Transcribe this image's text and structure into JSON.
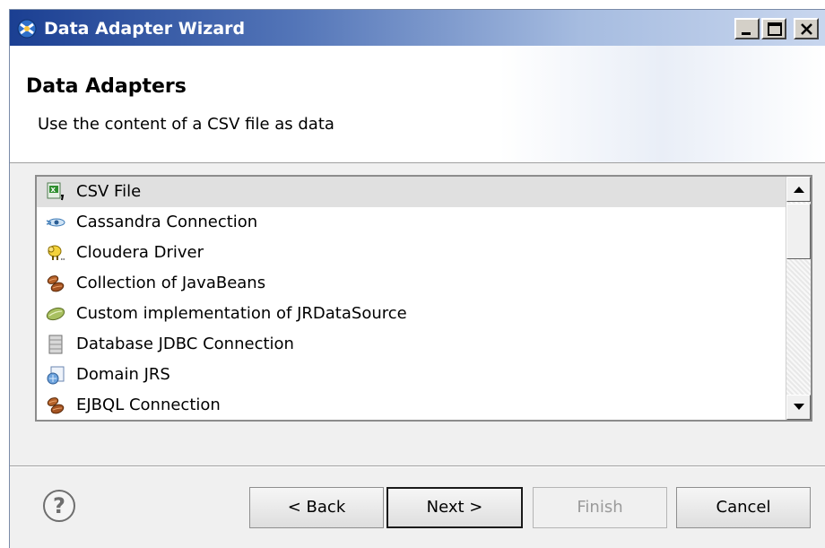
{
  "window": {
    "title": "Data Adapter Wizard",
    "icon": "data-adapter-app-icon"
  },
  "header": {
    "title": "Data Adapters",
    "description": "Use the content of a CSV file as data"
  },
  "adapters": [
    {
      "label": "CSV File",
      "icon": "csv-file-icon",
      "selected": true
    },
    {
      "label": "Cassandra Connection",
      "icon": "cassandra-eye-icon",
      "selected": false
    },
    {
      "label": "Cloudera Driver",
      "icon": "cloudera-elephant-icon",
      "selected": false
    },
    {
      "label": "Collection of JavaBeans",
      "icon": "javabeans-icon",
      "selected": false
    },
    {
      "label": "Custom implementation of JRDataSource",
      "icon": "bean-icon",
      "selected": false
    },
    {
      "label": "Database JDBC Connection",
      "icon": "database-icon",
      "selected": false
    },
    {
      "label": "Domain JRS",
      "icon": "domain-jrs-icon",
      "selected": false
    },
    {
      "label": "EJBQL Connection",
      "icon": "javabeans-icon",
      "selected": false
    }
  ],
  "buttons": {
    "back": "< Back",
    "next": "Next >",
    "finish": "Finish",
    "cancel": "Cancel"
  },
  "finish_enabled": false,
  "help_icon": "help-icon"
}
